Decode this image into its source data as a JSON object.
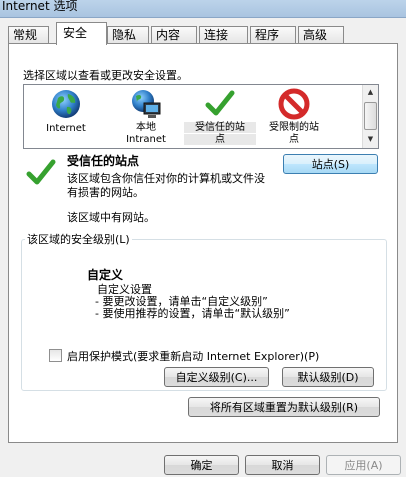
{
  "window": {
    "title": "Internet 选项"
  },
  "tabs": [
    "常规",
    "安全",
    "隐私",
    "内容",
    "连接",
    "程序",
    "高级"
  ],
  "security": {
    "zones_label": "选择区域以查看或更改安全设置。",
    "zones": [
      {
        "name": "Internet",
        "icon": "globe-icon"
      },
      {
        "name_line1": "本地",
        "name_line2": "Intranet",
        "icon": "intranet-icon"
      },
      {
        "name_line1": "受信任的站",
        "name_line2": "点",
        "icon": "checkmark-icon",
        "selected": true
      },
      {
        "name_line1": "受限制的站",
        "name_line2": "点",
        "icon": "restricted-icon"
      }
    ],
    "selected_zone_title": "受信任的站点",
    "selected_zone_desc": "该区域包含你信任对你的计算机或文件没有损害的网站。",
    "zone_note": "该区域中有网站。",
    "sites_button": "站点(S)",
    "level_group_label": "该区域的安全级别(L)",
    "level_title": "自定义",
    "level_lines": [
      "自定义设置",
      "- 要更改设置，请单击“自定义级别”",
      "- 要使用推荐的设置，请单击“默认级别”"
    ],
    "protected_mode_label": "启用保护模式(要求重新启动 Internet Explorer)(P)",
    "protected_mode_checked": false,
    "custom_level_button": "自定义级别(C)...",
    "default_level_button": "默认级别(D)",
    "reset_all_button": "将所有区域重置为默认级别(R)"
  },
  "footer": {
    "ok": "确定",
    "cancel": "取消",
    "apply": "应用(A)"
  },
  "colors": {
    "accent": "#3c7fb1",
    "check_green": "#36a12f",
    "restricted_red": "#d42a2a"
  }
}
